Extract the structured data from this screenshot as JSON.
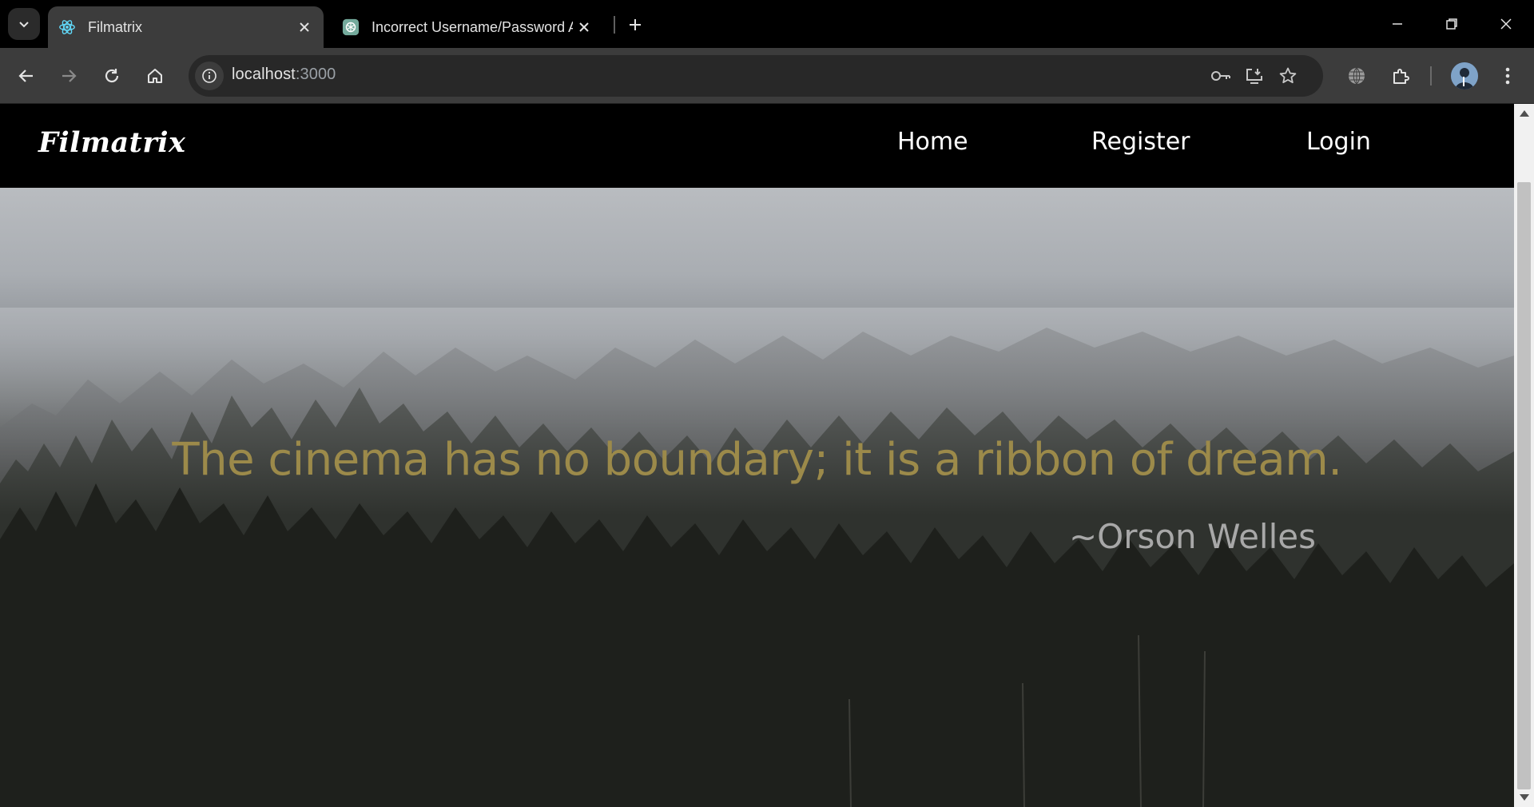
{
  "browser": {
    "tabs": [
      {
        "title": "Filmatrix",
        "active": true,
        "icon": "react-icon"
      },
      {
        "title": "Incorrect Username/Password A",
        "active": false,
        "icon": "chatgpt-icon"
      }
    ],
    "url_host": "localhost",
    "url_port": ":3000",
    "icons": [
      "tab-search-icon",
      "close-icon",
      "new-tab-icon",
      "minimize-icon",
      "restore-icon",
      "window-close-icon",
      "back-icon",
      "forward-icon",
      "reload-icon",
      "home-icon",
      "site-info-icon",
      "password-key-icon",
      "install-app-icon",
      "bookmark-star-icon",
      "translate-globe-icon",
      "extensions-icon",
      "profile-avatar",
      "menu-dots-icon"
    ]
  },
  "page": {
    "logo": "Filmatrix",
    "nav": {
      "home": "Home",
      "register": "Register",
      "login": "Login"
    },
    "hero": {
      "quote": "The cinema has no boundary; it is a ribbon of dream.",
      "author": "~Orson Welles"
    }
  },
  "colors": {
    "navbar_bg": "#000000",
    "quote_text": "#9c8a4a",
    "author_text": "#a8a8a8",
    "chrome_toolbar": "#3c3c3c",
    "omnibox_bg": "#282828"
  }
}
